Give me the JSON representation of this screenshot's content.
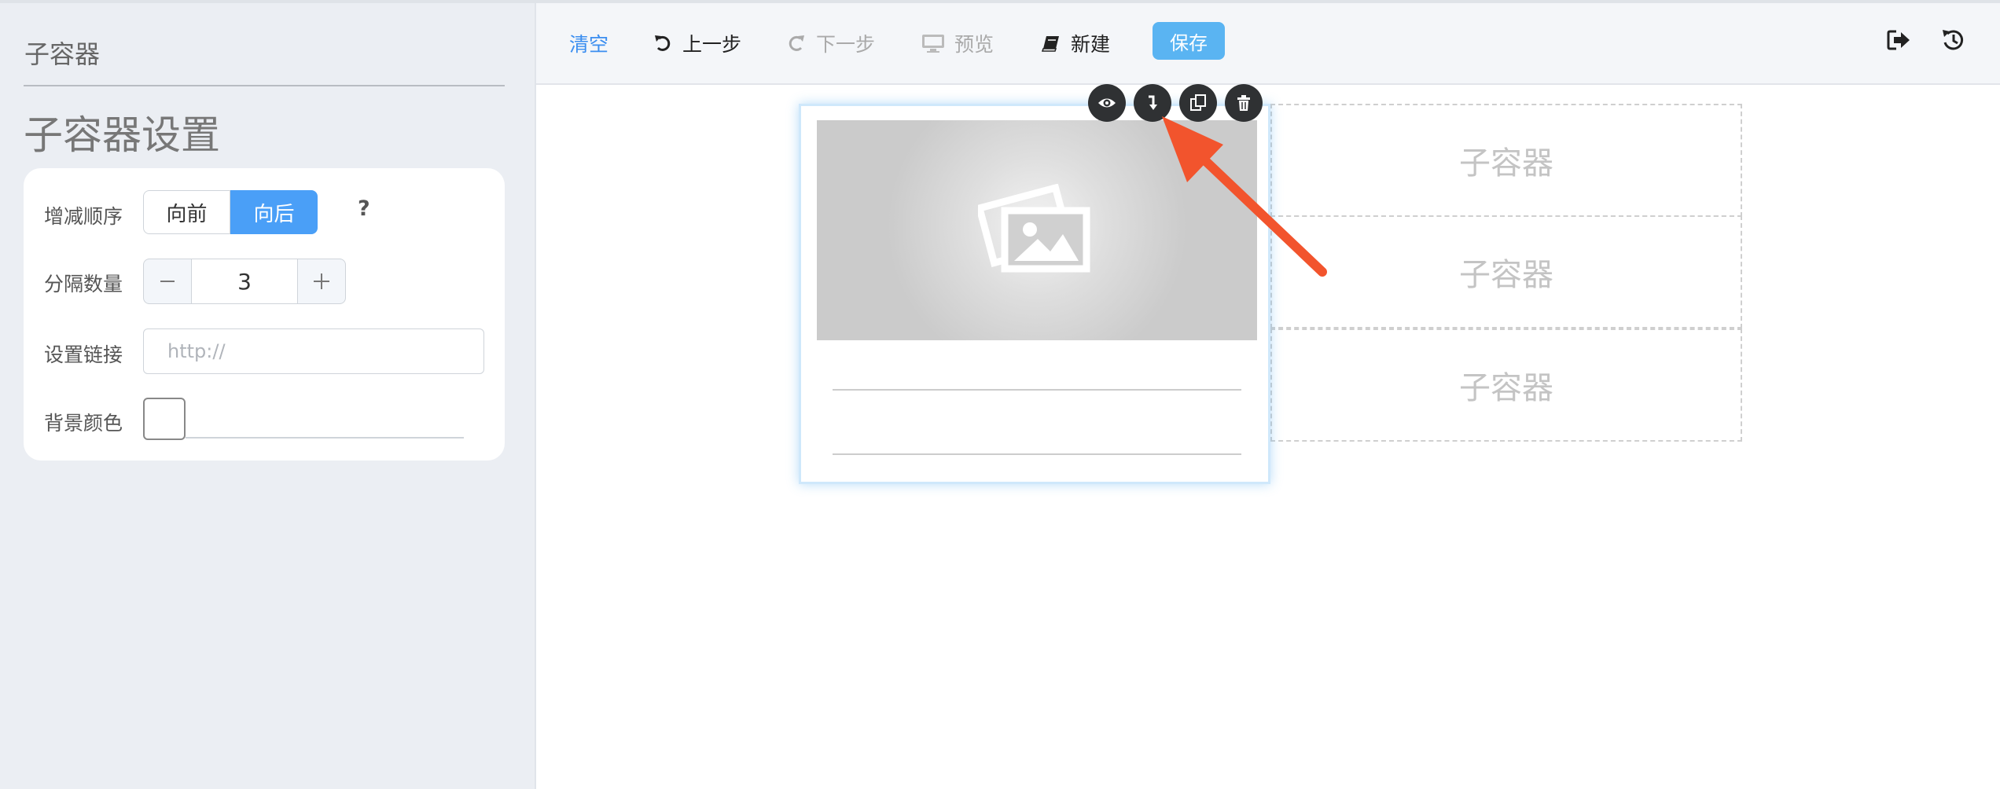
{
  "sidebar": {
    "header": "子容器",
    "title": "子容器设置",
    "order": {
      "label": "增减顺序",
      "options": [
        "向前",
        "向后"
      ],
      "selected": "向后",
      "help": "?"
    },
    "divider_count": {
      "label": "分隔数量",
      "value": "3",
      "minus": "−",
      "plus": "+"
    },
    "link": {
      "label": "设置链接",
      "placeholder": "http://"
    },
    "bg_color": {
      "label": "背景颜色"
    }
  },
  "toolbar": {
    "clear": "清空",
    "undo": "上一步",
    "redo": "下一步",
    "preview": "预览",
    "new": "新建",
    "save": "保存"
  },
  "canvas": {
    "sub_containers": [
      "子容器",
      "子容器",
      "子容器"
    ],
    "block_tools": [
      "eye-icon",
      "move-down-icon",
      "copy-icon",
      "trash-icon"
    ]
  },
  "colors": {
    "accent": "#4a9ff7",
    "save": "#5ab4f2",
    "arrow": "#f2542d"
  }
}
